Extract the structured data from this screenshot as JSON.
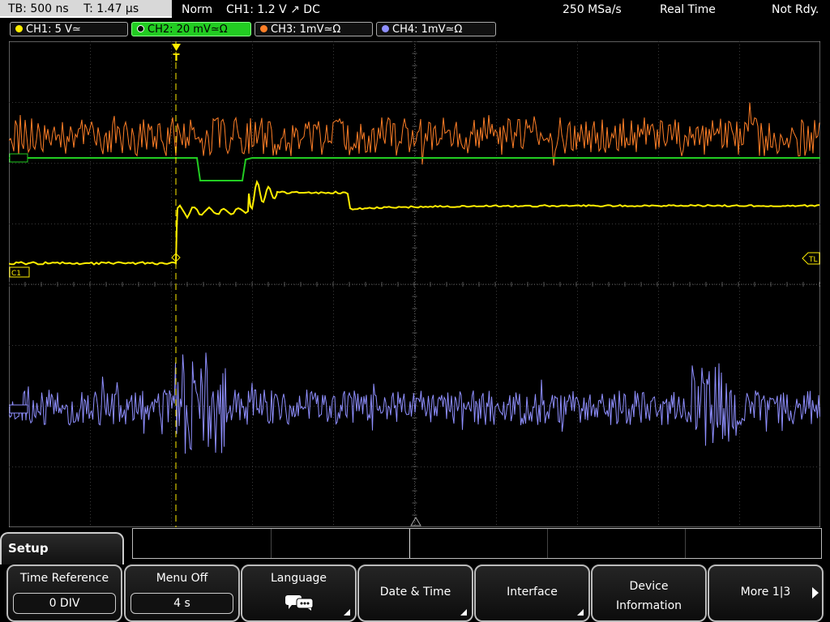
{
  "top": {
    "timebase": "TB: 500 ns",
    "time": "T: 1.47 µs",
    "mode": "Norm",
    "trigger": "CH1: 1.2 V ↗ DC",
    "sample_rate": "250 MSa/s",
    "acq": "Real Time",
    "status": "Not Rdy."
  },
  "channels": [
    {
      "label": "CH1: 5 V≃",
      "color": "#ffee00"
    },
    {
      "label": "CH2: 20 mV≃Ω",
      "color": "#22cc22"
    },
    {
      "label": "CH3: 1mV≃Ω",
      "color": "#ff7f27"
    },
    {
      "label": "CH4: 1mV≃Ω",
      "color": "#8f8fff"
    }
  ],
  "screen": {
    "trigger_marker": "T",
    "ch1_marker": "C1",
    "trigger_level_marker": "TL"
  },
  "menu": {
    "title": "Setup",
    "time_reference": {
      "label": "Time Reference",
      "value": "0 DIV"
    },
    "menu_off": {
      "label": "Menu Off",
      "value": "4 s"
    },
    "language": {
      "label": "Language"
    },
    "date_time": {
      "label": "Date & Time"
    },
    "interface": {
      "label": "Interface"
    },
    "device_info": {
      "line1": "Device",
      "line2": "Information"
    },
    "more": {
      "label": "More 1|3"
    }
  },
  "colors": {
    "ch1": "#ffee00",
    "ch2": "#22cc22",
    "ch3": "#ff7f27",
    "ch4": "#8f8fff",
    "grid": "#3a3a3a"
  }
}
